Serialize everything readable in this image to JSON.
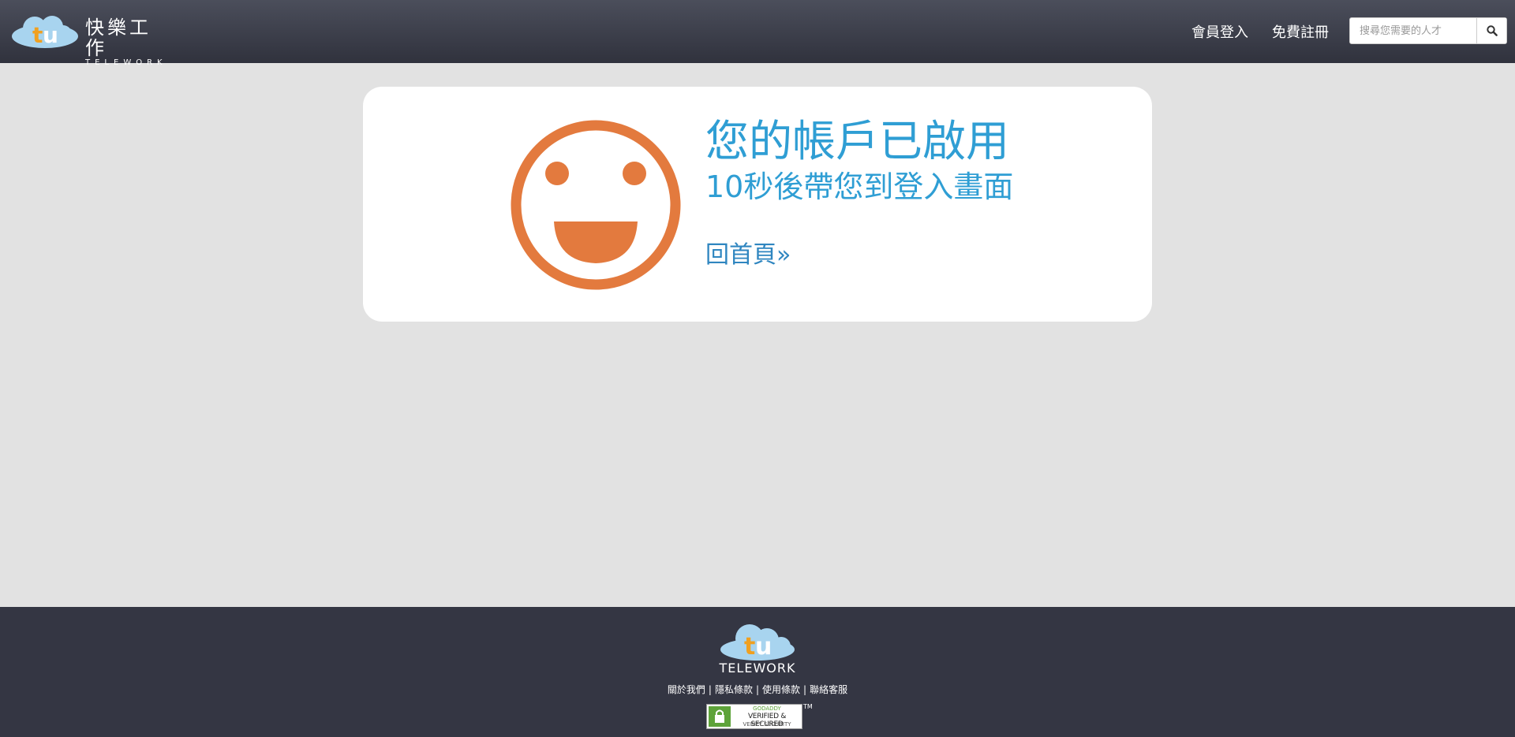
{
  "header": {
    "logo_cn": "快樂工作",
    "logo_en": "TELEWORK",
    "nav": {
      "login": "會員登入",
      "register": "免費註冊"
    },
    "search": {
      "placeholder": "搜尋您需要的人才",
      "icon": "search-icon"
    }
  },
  "main": {
    "icon": "smiley-face-icon",
    "title": "您的帳戶已啟用",
    "subtitle": "10秒後帶您到登入畫面",
    "home_link": "回首頁»"
  },
  "footer": {
    "logo_text": "TELEWORK",
    "links": [
      "關於我們",
      "隱私條款",
      "使用條款",
      "聯絡客服"
    ],
    "separator": "|",
    "badge": {
      "top": "GODADDY",
      "main": "VERIFIED & SECURED",
      "sub": "VERIFY SECURITY",
      "tm": "TM"
    }
  },
  "colors": {
    "header_bg": "#3f424e",
    "page_bg": "#e2e2e2",
    "accent_blue": "#2f9ed4",
    "smiley_orange": "#e37a3e",
    "footer_bg": "#343643",
    "logo_orange": "#f0a020",
    "logo_cloud": "#a8d4ef"
  }
}
